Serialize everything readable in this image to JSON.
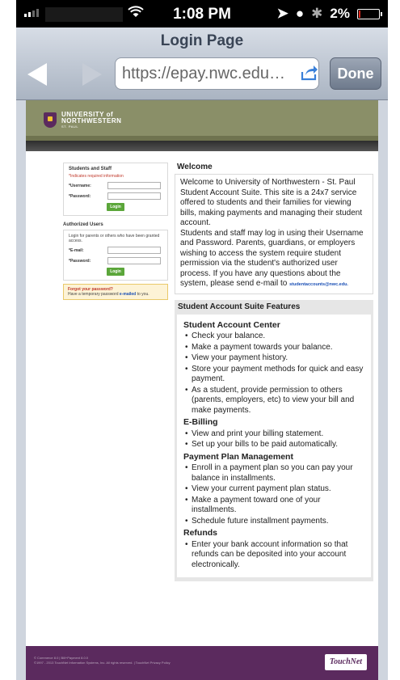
{
  "status_bar": {
    "time": "1:08 PM",
    "battery_percent": "2%",
    "battery_level": 0.02,
    "icons": [
      "signal-icon",
      "wifi-icon",
      "location-icon",
      "clock-icon",
      "bluetooth-icon",
      "battery-icon"
    ]
  },
  "browser": {
    "title": "Login Page",
    "url": "https://epay.nwc.edu…",
    "done_label": "Done"
  },
  "site": {
    "logo_line1": "UNIVERSITY of",
    "logo_line2": "NORTHWESTERN",
    "logo_line3": "ST. PAUL"
  },
  "login": {
    "students_title": "Students and Staff",
    "required_note": "*Indicates required information",
    "username_label": "*Username:",
    "password_label": "*Password:",
    "login_label": "Login",
    "authorized_title": "Authorized Users",
    "authorized_help": "Login for parents or others who have been granted access.",
    "email_label": "*E-mail:",
    "auth_password_label": "*Password:",
    "auth_login_label": "Login",
    "forgot_title": "Forgot your password?",
    "forgot_text": "Have a temporary password",
    "forgot_link": "e-mailed",
    "forgot_suffix": "to you."
  },
  "welcome": {
    "title": "Welcome",
    "para1": "Welcome to University of Northwestern - St. Paul Student Account Suite. This site is a 24x7 service offered to students and their families for viewing bills, making payments and managing their student account.",
    "para2": "Students and staff may log in using their Username and Password. Parents, guardians, or employers wishing to access the system require student permission via the student's authorized user process. If you have any questions about the system, please send e-mail to",
    "email": "studentaccounts@nwc.edu."
  },
  "features": {
    "title": "Student Account Suite Features",
    "sections": [
      {
        "heading": "Student Account Center",
        "items": [
          "Check your balance.",
          "Make a payment towards your balance.",
          "View your payment history.",
          "Store your payment methods for quick and easy payment.",
          "As a student, provide permission to others (parents, employers, etc) to view your bill and make payments."
        ]
      },
      {
        "heading": "E-Billing",
        "items": [
          "View and print your billing statement.",
          "Set up your bills to be paid automatically."
        ]
      },
      {
        "heading": "Payment Plan Management",
        "items": [
          "Enroll in a payment plan so you can pay your balance in installments.",
          "View your current payment plan status.",
          "Make a payment toward one of your installments.",
          "Schedule future installment payments."
        ]
      },
      {
        "heading": "Refunds",
        "items": [
          "Enter your bank account information so that refunds can be deposited into your account electronically."
        ]
      }
    ]
  },
  "footer": {
    "line1": "© Commerce 8.0 | Bill+Payment 8.0.0",
    "line2": "©1997 - 2013 TouchNet Information Systems, Inc. All rights reserved. | TouchNet Privacy Policy",
    "brand": "TouchNet"
  },
  "colors": {
    "header_olive": "#8a8f68",
    "footer_purple": "#5b2a5e",
    "login_green": "#5ba63a",
    "link_blue": "#1a4fb5",
    "required_red": "#c0392b"
  }
}
